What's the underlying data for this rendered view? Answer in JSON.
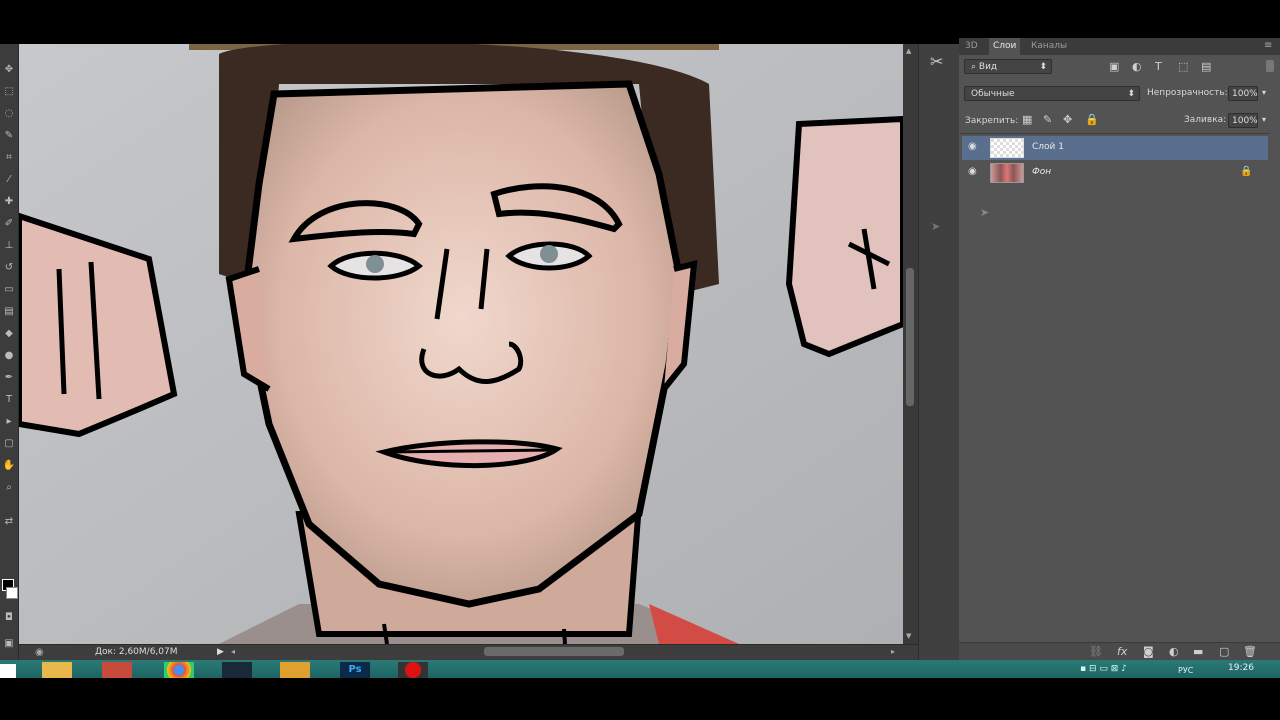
{
  "panel": {
    "tabs": [
      "3D",
      "Слои",
      "Каналы"
    ],
    "active_tab": "Слои",
    "filter_kind": "Вид",
    "blend_mode": "Обычные",
    "opacity_label": "Непрозрачность:",
    "opacity_value": "100%",
    "lock_label": "Закрепить:",
    "fill_label": "Заливка:",
    "fill_value": "100%",
    "layers": [
      {
        "name": "Слой 1",
        "active": true
      },
      {
        "name": "Фон",
        "active": false,
        "locked": true
      }
    ],
    "bottom_icons": [
      "link-icon",
      "fx-icon",
      "mask-icon",
      "adjustment-icon",
      "folder-icon",
      "new-layer-icon",
      "trash-icon"
    ]
  },
  "status": {
    "doc_size": "Док: 2,60M/6,07M"
  },
  "taskbar": {
    "time": "19:26",
    "lang": "РУС"
  },
  "colors": {
    "panel_bg": "#535353",
    "active_layer": "#5a6f8e",
    "taskbar": "#2b7a77"
  }
}
